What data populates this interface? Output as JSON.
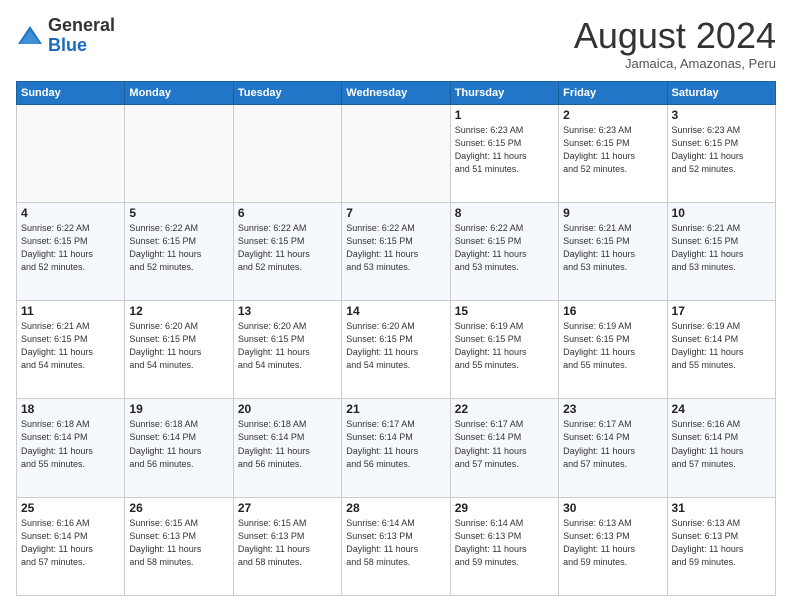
{
  "header": {
    "logo_line1": "General",
    "logo_line2": "Blue",
    "month": "August 2024",
    "location": "Jamaica, Amazonas, Peru"
  },
  "days_of_week": [
    "Sunday",
    "Monday",
    "Tuesday",
    "Wednesday",
    "Thursday",
    "Friday",
    "Saturday"
  ],
  "weeks": [
    [
      {
        "day": "",
        "info": ""
      },
      {
        "day": "",
        "info": ""
      },
      {
        "day": "",
        "info": ""
      },
      {
        "day": "",
        "info": ""
      },
      {
        "day": "1",
        "info": "Sunrise: 6:23 AM\nSunset: 6:15 PM\nDaylight: 11 hours\nand 51 minutes."
      },
      {
        "day": "2",
        "info": "Sunrise: 6:23 AM\nSunset: 6:15 PM\nDaylight: 11 hours\nand 52 minutes."
      },
      {
        "day": "3",
        "info": "Sunrise: 6:23 AM\nSunset: 6:15 PM\nDaylight: 11 hours\nand 52 minutes."
      }
    ],
    [
      {
        "day": "4",
        "info": "Sunrise: 6:22 AM\nSunset: 6:15 PM\nDaylight: 11 hours\nand 52 minutes."
      },
      {
        "day": "5",
        "info": "Sunrise: 6:22 AM\nSunset: 6:15 PM\nDaylight: 11 hours\nand 52 minutes."
      },
      {
        "day": "6",
        "info": "Sunrise: 6:22 AM\nSunset: 6:15 PM\nDaylight: 11 hours\nand 52 minutes."
      },
      {
        "day": "7",
        "info": "Sunrise: 6:22 AM\nSunset: 6:15 PM\nDaylight: 11 hours\nand 53 minutes."
      },
      {
        "day": "8",
        "info": "Sunrise: 6:22 AM\nSunset: 6:15 PM\nDaylight: 11 hours\nand 53 minutes."
      },
      {
        "day": "9",
        "info": "Sunrise: 6:21 AM\nSunset: 6:15 PM\nDaylight: 11 hours\nand 53 minutes."
      },
      {
        "day": "10",
        "info": "Sunrise: 6:21 AM\nSunset: 6:15 PM\nDaylight: 11 hours\nand 53 minutes."
      }
    ],
    [
      {
        "day": "11",
        "info": "Sunrise: 6:21 AM\nSunset: 6:15 PM\nDaylight: 11 hours\nand 54 minutes."
      },
      {
        "day": "12",
        "info": "Sunrise: 6:20 AM\nSunset: 6:15 PM\nDaylight: 11 hours\nand 54 minutes."
      },
      {
        "day": "13",
        "info": "Sunrise: 6:20 AM\nSunset: 6:15 PM\nDaylight: 11 hours\nand 54 minutes."
      },
      {
        "day": "14",
        "info": "Sunrise: 6:20 AM\nSunset: 6:15 PM\nDaylight: 11 hours\nand 54 minutes."
      },
      {
        "day": "15",
        "info": "Sunrise: 6:19 AM\nSunset: 6:15 PM\nDaylight: 11 hours\nand 55 minutes."
      },
      {
        "day": "16",
        "info": "Sunrise: 6:19 AM\nSunset: 6:15 PM\nDaylight: 11 hours\nand 55 minutes."
      },
      {
        "day": "17",
        "info": "Sunrise: 6:19 AM\nSunset: 6:14 PM\nDaylight: 11 hours\nand 55 minutes."
      }
    ],
    [
      {
        "day": "18",
        "info": "Sunrise: 6:18 AM\nSunset: 6:14 PM\nDaylight: 11 hours\nand 55 minutes."
      },
      {
        "day": "19",
        "info": "Sunrise: 6:18 AM\nSunset: 6:14 PM\nDaylight: 11 hours\nand 56 minutes."
      },
      {
        "day": "20",
        "info": "Sunrise: 6:18 AM\nSunset: 6:14 PM\nDaylight: 11 hours\nand 56 minutes."
      },
      {
        "day": "21",
        "info": "Sunrise: 6:17 AM\nSunset: 6:14 PM\nDaylight: 11 hours\nand 56 minutes."
      },
      {
        "day": "22",
        "info": "Sunrise: 6:17 AM\nSunset: 6:14 PM\nDaylight: 11 hours\nand 57 minutes."
      },
      {
        "day": "23",
        "info": "Sunrise: 6:17 AM\nSunset: 6:14 PM\nDaylight: 11 hours\nand 57 minutes."
      },
      {
        "day": "24",
        "info": "Sunrise: 6:16 AM\nSunset: 6:14 PM\nDaylight: 11 hours\nand 57 minutes."
      }
    ],
    [
      {
        "day": "25",
        "info": "Sunrise: 6:16 AM\nSunset: 6:14 PM\nDaylight: 11 hours\nand 57 minutes."
      },
      {
        "day": "26",
        "info": "Sunrise: 6:15 AM\nSunset: 6:13 PM\nDaylight: 11 hours\nand 58 minutes."
      },
      {
        "day": "27",
        "info": "Sunrise: 6:15 AM\nSunset: 6:13 PM\nDaylight: 11 hours\nand 58 minutes."
      },
      {
        "day": "28",
        "info": "Sunrise: 6:14 AM\nSunset: 6:13 PM\nDaylight: 11 hours\nand 58 minutes."
      },
      {
        "day": "29",
        "info": "Sunrise: 6:14 AM\nSunset: 6:13 PM\nDaylight: 11 hours\nand 59 minutes."
      },
      {
        "day": "30",
        "info": "Sunrise: 6:13 AM\nSunset: 6:13 PM\nDaylight: 11 hours\nand 59 minutes."
      },
      {
        "day": "31",
        "info": "Sunrise: 6:13 AM\nSunset: 6:13 PM\nDaylight: 11 hours\nand 59 minutes."
      }
    ]
  ]
}
